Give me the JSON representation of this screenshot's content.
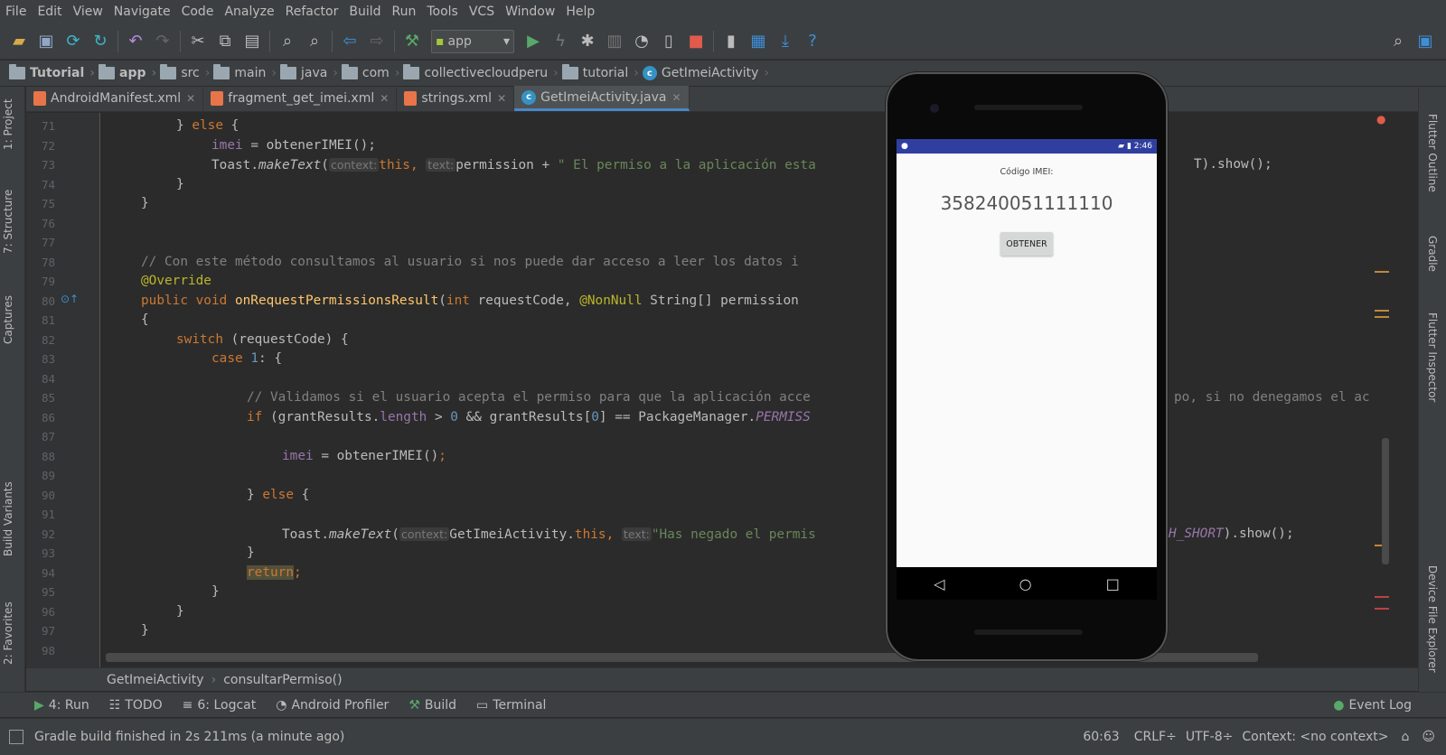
{
  "menu": [
    "File",
    "Edit",
    "View",
    "Navigate",
    "Code",
    "Analyze",
    "Refactor",
    "Build",
    "Run",
    "Tools",
    "VCS",
    "Window",
    "Help"
  ],
  "toolbar": {
    "run_config": "app"
  },
  "breadcrumbs": [
    "Tutorial",
    "app",
    "src",
    "main",
    "java",
    "com",
    "collectivecloudperu",
    "tutorial",
    "GetImeiActivity"
  ],
  "tabs": [
    "AndroidManifest.xml",
    "fragment_get_imei.xml",
    "strings.xml",
    "GetImeiActivity.java"
  ],
  "left_tools": [
    "1: Project",
    "7: Structure",
    "Captures",
    "Build Variants",
    "2: Favorites"
  ],
  "right_tools": [
    "Flutter Outline",
    "Gradle",
    "Flutter Inspector",
    "Device File Explorer"
  ],
  "line_numbers": [
    "71",
    "72",
    "73",
    "74",
    "75",
    "76",
    "77",
    "78",
    "79",
    "80",
    "81",
    "82",
    "83",
    "84",
    "85",
    "86",
    "87",
    "88",
    "89",
    "90",
    "91",
    "92",
    "93",
    "94",
    "95",
    "96",
    "97",
    "98"
  ],
  "code": {
    "l71a": "} ",
    "l71b": "else",
    "l71c": " {",
    "l72a": "imei",
    "l72b": " = ",
    "l72c": "obtenerIMEI",
    "l72d": "();",
    "l73a": "Toast.",
    "l73b": "makeText",
    "l73c": "(",
    "l73h1": "context:",
    "l73d": "this",
    "l73e": ",",
    "l73h2": "text:",
    "l73f": "permission + ",
    "l73g": "\" El permiso a la aplicación esta",
    "l73i": "T).show();",
    "l74": "}",
    "l75": "}",
    "l78": "// Con este método consultamos al usuario si nos puede dar acceso a leer los datos i",
    "l79": "@Override",
    "l80a": "public void ",
    "l80b": "onRequestPermissionsResult",
    "l80c": "(",
    "l80d": "int",
    "l80e": " requestCode, ",
    "l80f": "@NonNull",
    "l80g": " String[] permission",
    "l81": "{",
    "l82a": "switch",
    "l82b": " (requestCode) {",
    "l83a": "case ",
    "l83b": "1",
    "l83c": ": {",
    "l85a": "// Validamos si el usuario acepta el permiso para que la aplicación acce",
    "l85b": "po, si no denegamos el ac",
    "l86a": "if",
    "l86b": " (grantResults.",
    "l86c": "length",
    "l86d": " > ",
    "l86e": "0",
    "l86f": " && grantResults[",
    "l86g": "0",
    "l86h": "] == PackageManager.",
    "l86i": "PERMISS",
    "l88a": "imei",
    "l88b": " = obtenerIMEI()",
    "l88c": ";",
    "l90a": "} ",
    "l90b": "else",
    "l90c": " {",
    "l92a": "Toast.",
    "l92b": "makeText",
    "l92c": "(",
    "l92h1": "context:",
    "l92d": "GetImeiActivity.",
    "l92e": "this",
    "l92f": ",",
    "l92h2": "text:",
    "l92g": "\"Has negado el permis",
    "l92i": "H_SHORT",
    "l92j": ").show();",
    "l93": "}",
    "l94a": "return",
    "l94b": ";",
    "l95": "}",
    "l96": "}",
    "l97": "}"
  },
  "bottom_breadcrumb": [
    "GetImeiActivity",
    "consultarPermiso()"
  ],
  "tool_windows": [
    "4: Run",
    "TODO",
    "6: Logcat",
    "Android Profiler",
    "Build",
    "Terminal"
  ],
  "event_log": "Event Log",
  "status": {
    "message": "Gradle build finished in 2s 211ms (a minute ago)",
    "position": "60:63",
    "line_sep": "CRLF÷",
    "encoding": "UTF-8÷",
    "context": "Context: <no context>"
  },
  "emulator": {
    "time": "2:46",
    "label": "Código IMEI:",
    "imei": "358240051111110",
    "button": "OBTENER"
  },
  "colors": {
    "keyword": "#cc7832",
    "comment": "#808080",
    "string": "#6a8759",
    "number": "#6897bb",
    "field": "#9876aa",
    "method": "#ffc66d",
    "annotation": "#bbb529",
    "android_statusbar": "#303f9f"
  }
}
